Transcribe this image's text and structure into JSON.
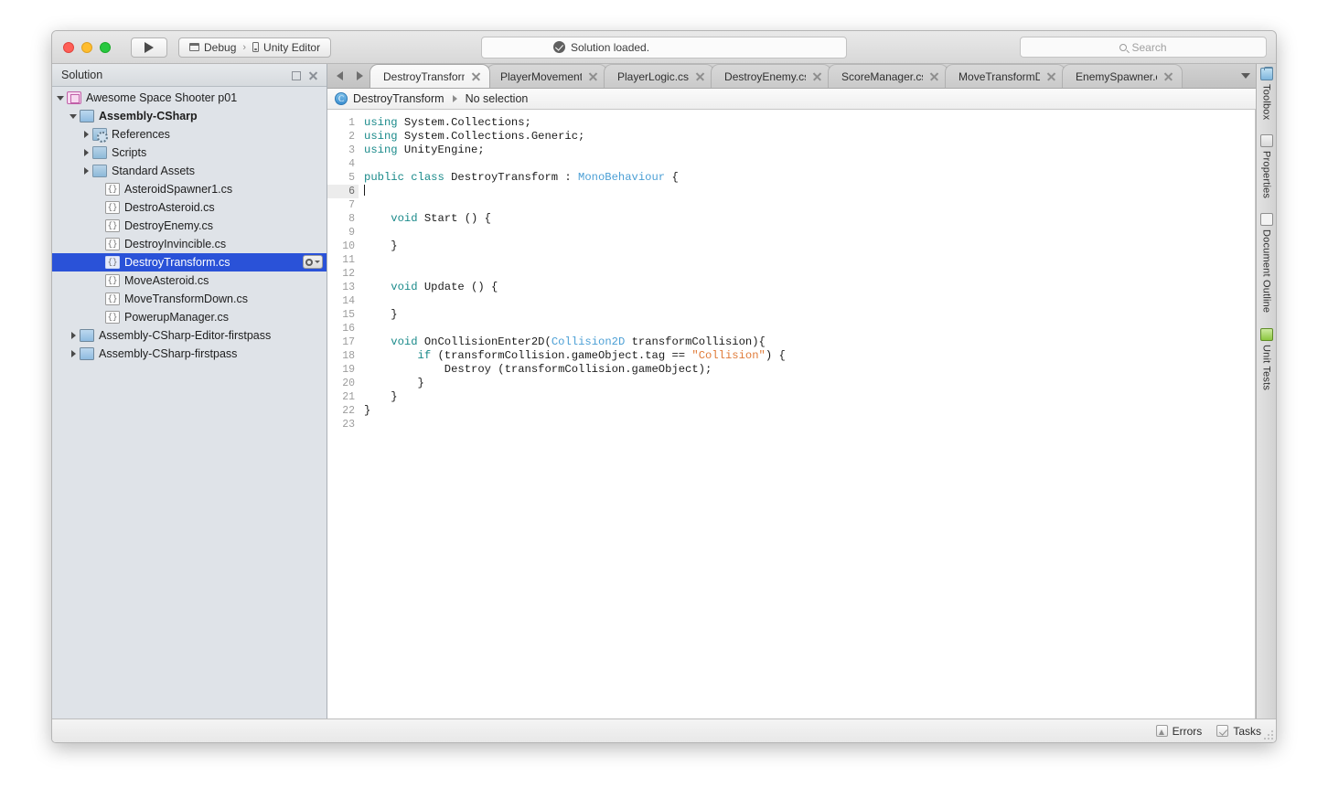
{
  "titlebar": {
    "run_label": "run-button",
    "config": {
      "debug": "Debug",
      "separator": "›",
      "target": "Unity Editor"
    },
    "status": "Solution loaded.",
    "search_placeholder": "Search"
  },
  "solution_pad": {
    "title": "Solution",
    "tree": [
      {
        "label": "Awesome Space Shooter p01",
        "indent": 0,
        "disc": "open",
        "icon": "solution",
        "bold": false,
        "selected": false
      },
      {
        "label": "Assembly-CSharp",
        "indent": 1,
        "disc": "open",
        "icon": "project",
        "bold": true,
        "selected": false
      },
      {
        "label": "References",
        "indent": 2,
        "disc": "closed",
        "icon": "references",
        "bold": false,
        "selected": false
      },
      {
        "label": "Scripts",
        "indent": 2,
        "disc": "closed",
        "icon": "folder",
        "bold": false,
        "selected": false
      },
      {
        "label": "Standard Assets",
        "indent": 2,
        "disc": "closed",
        "icon": "folder",
        "bold": false,
        "selected": false
      },
      {
        "label": "AsteroidSpawner1.cs",
        "indent": 3,
        "disc": "none",
        "icon": "cs",
        "bold": false,
        "selected": false
      },
      {
        "label": "DestroAsteroid.cs",
        "indent": 3,
        "disc": "none",
        "icon": "cs",
        "bold": false,
        "selected": false
      },
      {
        "label": "DestroyEnemy.cs",
        "indent": 3,
        "disc": "none",
        "icon": "cs",
        "bold": false,
        "selected": false
      },
      {
        "label": "DestroyInvincible.cs",
        "indent": 3,
        "disc": "none",
        "icon": "cs",
        "bold": false,
        "selected": false
      },
      {
        "label": "DestroyTransform.cs",
        "indent": 3,
        "disc": "none",
        "icon": "cs",
        "bold": false,
        "selected": true
      },
      {
        "label": "MoveAsteroid.cs",
        "indent": 3,
        "disc": "none",
        "icon": "cs",
        "bold": false,
        "selected": false
      },
      {
        "label": "MoveTransformDown.cs",
        "indent": 3,
        "disc": "none",
        "icon": "cs",
        "bold": false,
        "selected": false
      },
      {
        "label": "PowerupManager.cs",
        "indent": 3,
        "disc": "none",
        "icon": "cs",
        "bold": false,
        "selected": false
      },
      {
        "label": "Assembly-CSharp-Editor-firstpass",
        "indent": 1,
        "disc": "closed",
        "icon": "project",
        "bold": false,
        "selected": false
      },
      {
        "label": "Assembly-CSharp-firstpass",
        "indent": 1,
        "disc": "closed",
        "icon": "project",
        "bold": false,
        "selected": false
      }
    ]
  },
  "tabs": [
    {
      "label": "DestroyTransform.cs",
      "active": true
    },
    {
      "label": "PlayerMovement.cs",
      "active": false
    },
    {
      "label": "PlayerLogic.cs",
      "active": false
    },
    {
      "label": "DestroyEnemy.cs",
      "active": false
    },
    {
      "label": "ScoreManager.cs",
      "active": false
    },
    {
      "label": "MoveTransformDown.cs",
      "active": false
    },
    {
      "label": "EnemySpawner.cs",
      "active": false
    }
  ],
  "breadcrumb": {
    "class_name": "DestroyTransform",
    "member": "No selection"
  },
  "editor": {
    "current_line": 6,
    "lines": [
      {
        "n": 1,
        "tokens": [
          {
            "t": "using",
            "c": "kw"
          },
          {
            "t": " System.Collections;",
            "c": ""
          }
        ]
      },
      {
        "n": 2,
        "tokens": [
          {
            "t": "using",
            "c": "kw"
          },
          {
            "t": " System.Collections.Generic;",
            "c": ""
          }
        ]
      },
      {
        "n": 3,
        "tokens": [
          {
            "t": "using",
            "c": "kw"
          },
          {
            "t": " UnityEngine;",
            "c": ""
          }
        ]
      },
      {
        "n": 4,
        "tokens": []
      },
      {
        "n": 5,
        "tokens": [
          {
            "t": "public class",
            "c": "kw"
          },
          {
            "t": " DestroyTransform : ",
            "c": ""
          },
          {
            "t": "MonoBehaviour",
            "c": "typ"
          },
          {
            "t": " {",
            "c": ""
          }
        ]
      },
      {
        "n": 6,
        "tokens": []
      },
      {
        "n": 7,
        "tokens": []
      },
      {
        "n": 8,
        "tokens": [
          {
            "t": "    ",
            "c": ""
          },
          {
            "t": "void",
            "c": "kw"
          },
          {
            "t": " Start () {",
            "c": ""
          }
        ]
      },
      {
        "n": 9,
        "tokens": []
      },
      {
        "n": 10,
        "tokens": [
          {
            "t": "    }",
            "c": ""
          }
        ]
      },
      {
        "n": 11,
        "tokens": []
      },
      {
        "n": 12,
        "tokens": []
      },
      {
        "n": 13,
        "tokens": [
          {
            "t": "    ",
            "c": ""
          },
          {
            "t": "void",
            "c": "kw"
          },
          {
            "t": " Update () {",
            "c": ""
          }
        ]
      },
      {
        "n": 14,
        "tokens": []
      },
      {
        "n": 15,
        "tokens": [
          {
            "t": "    }",
            "c": ""
          }
        ]
      },
      {
        "n": 16,
        "tokens": []
      },
      {
        "n": 17,
        "tokens": [
          {
            "t": "    ",
            "c": ""
          },
          {
            "t": "void",
            "c": "kw"
          },
          {
            "t": " OnCollisionEnter2D(",
            "c": ""
          },
          {
            "t": "Collision2D",
            "c": "typ"
          },
          {
            "t": " transformCollision){",
            "c": ""
          }
        ]
      },
      {
        "n": 18,
        "tokens": [
          {
            "t": "        ",
            "c": ""
          },
          {
            "t": "if",
            "c": "kw"
          },
          {
            "t": " (transformCollision.gameObject.tag == ",
            "c": ""
          },
          {
            "t": "\"Collision\"",
            "c": "str"
          },
          {
            "t": ") {",
            "c": ""
          }
        ]
      },
      {
        "n": 19,
        "tokens": [
          {
            "t": "            Destroy (transformCollision.gameObject);",
            "c": ""
          }
        ]
      },
      {
        "n": 20,
        "tokens": [
          {
            "t": "        }",
            "c": ""
          }
        ]
      },
      {
        "n": 21,
        "tokens": [
          {
            "t": "    }",
            "c": ""
          }
        ]
      },
      {
        "n": 22,
        "tokens": [
          {
            "t": "}",
            "c": ""
          }
        ]
      },
      {
        "n": 23,
        "tokens": []
      }
    ]
  },
  "right_pads": [
    {
      "label": "Toolbox",
      "icon": "toolbox"
    },
    {
      "label": "Properties",
      "icon": "props"
    },
    {
      "label": "Document Outline",
      "icon": "outline"
    },
    {
      "label": "Unit Tests",
      "icon": "tests"
    }
  ],
  "statusbar": {
    "errors": "Errors",
    "tasks": "Tasks"
  },
  "colors": {
    "selection_blue": "#2a52d8",
    "keyword": "#1a8a8a",
    "type": "#4b9fd5",
    "string": "#e07b39"
  }
}
